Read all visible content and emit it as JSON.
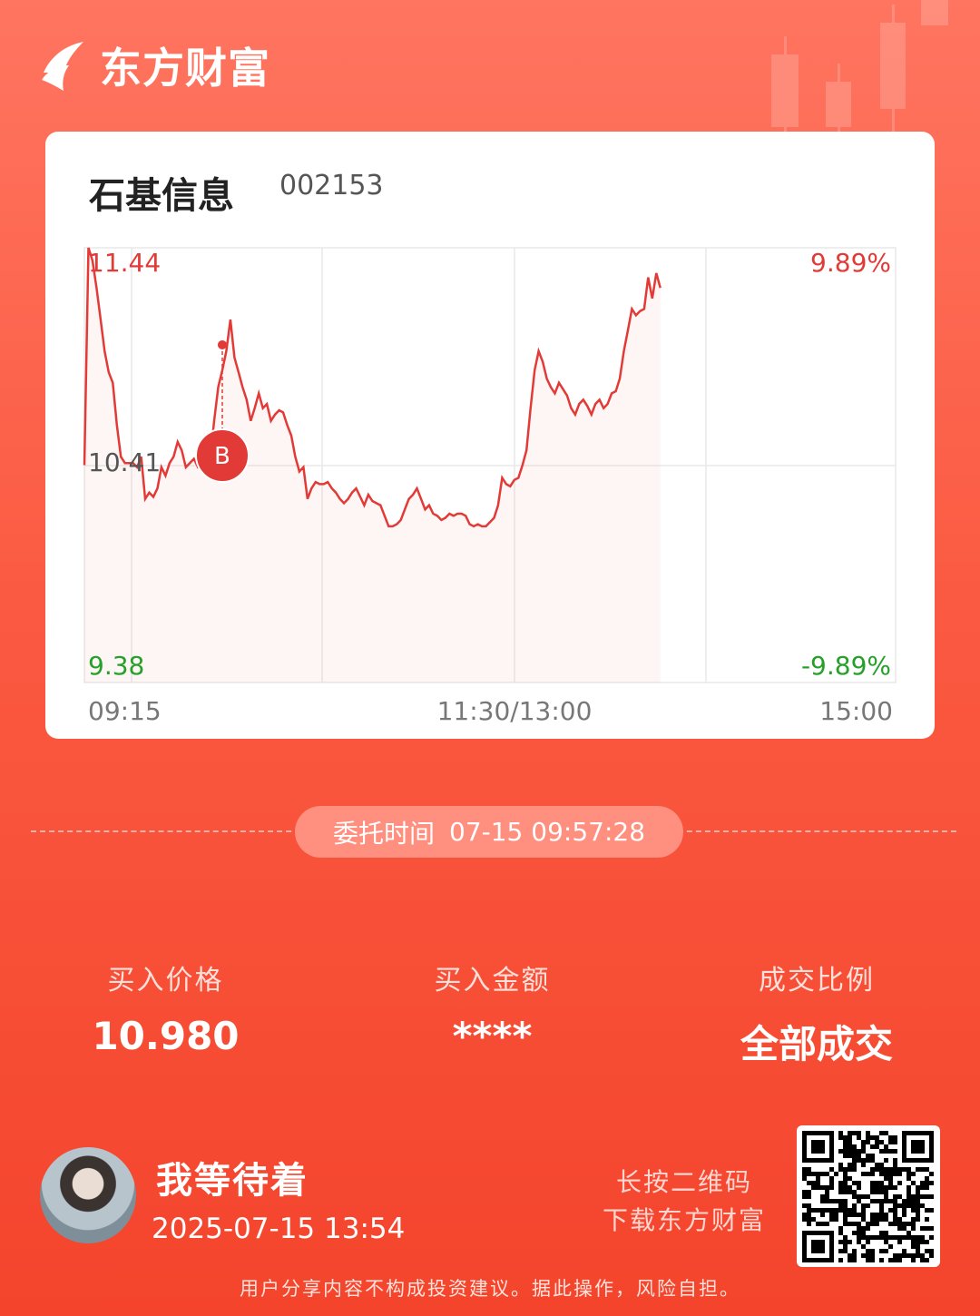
{
  "brand": {
    "name": "东方财富"
  },
  "stock": {
    "name": "石基信息",
    "code": "002153"
  },
  "chart_data": {
    "type": "line",
    "title": "",
    "price_max": "11.44",
    "price_mid": "10.41",
    "price_min": "9.38",
    "pct_max": "9.89%",
    "pct_min": "-9.89%",
    "ylim": [
      9.38,
      11.44
    ],
    "x_ticks": [
      "09:15",
      "11:30/13:00",
      "15:00"
    ],
    "grid": true,
    "buy_marker": {
      "label": "B",
      "time_index": 34,
      "price": 10.98
    },
    "series": [
      {
        "values": [
          10.41,
          11.44,
          11.38,
          11.25,
          11.1,
          10.95,
          10.85,
          10.8,
          10.6,
          10.45,
          10.42,
          10.42,
          10.42,
          10.4,
          10.45,
          10.25,
          10.28,
          10.26,
          10.3,
          10.4,
          10.36,
          10.42,
          10.45,
          10.52,
          10.48,
          10.4,
          10.42,
          10.44,
          10.4,
          10.41,
          10.46,
          10.44,
          10.62,
          10.78,
          10.86,
          10.95,
          11.1,
          10.92,
          10.85,
          10.78,
          10.72,
          10.62,
          10.68,
          10.75,
          10.68,
          10.7,
          10.62,
          10.65,
          10.67,
          10.66,
          10.6,
          10.55,
          10.45,
          10.38,
          10.4,
          10.25,
          10.3,
          10.33,
          10.32,
          10.32,
          10.33,
          10.3,
          10.28,
          10.25,
          10.23,
          10.25,
          10.28,
          10.3,
          10.26,
          10.22,
          10.27,
          10.24,
          10.23,
          10.22,
          10.17,
          10.12,
          10.12,
          10.13,
          10.15,
          10.2,
          10.25,
          10.27,
          10.3,
          10.25,
          10.2,
          10.22,
          10.18,
          10.17,
          10.15,
          10.16,
          10.18,
          10.17,
          10.18,
          10.18,
          10.17,
          10.13,
          10.12,
          10.13,
          10.12,
          10.12,
          10.14,
          10.16,
          10.22,
          10.35,
          10.32,
          10.31,
          10.34,
          10.35,
          10.41,
          10.48,
          10.68,
          10.86,
          10.95,
          10.9,
          10.82,
          10.78,
          10.75,
          10.8,
          10.77,
          10.74,
          10.68,
          10.65,
          10.7,
          10.72,
          10.69,
          10.65,
          10.7,
          10.72,
          10.68,
          10.7,
          10.75,
          10.76,
          10.82,
          10.95,
          11.05,
          11.15,
          11.12,
          11.14,
          11.15,
          11.3,
          11.2,
          11.32,
          11.25
        ]
      }
    ]
  },
  "order": {
    "time_label": "委托时间",
    "time_value": "07-15 09:57:28"
  },
  "stats": [
    {
      "label": "买入价格",
      "value": "10.980"
    },
    {
      "label": "买入金额",
      "value": "****"
    },
    {
      "label": "成交比例",
      "value": "全部成交"
    }
  ],
  "user": {
    "name": "我等待着",
    "datetime": "2025-07-15 13:54"
  },
  "qr": {
    "hint_line1": "长按二维码",
    "hint_line2": "下载东方财富"
  },
  "disclaimer": "用户分享内容不构成投资建议。据此操作，风险自担。",
  "colors": {
    "up": "#e23a36",
    "down": "#25a028",
    "accent": "#f4442c"
  }
}
